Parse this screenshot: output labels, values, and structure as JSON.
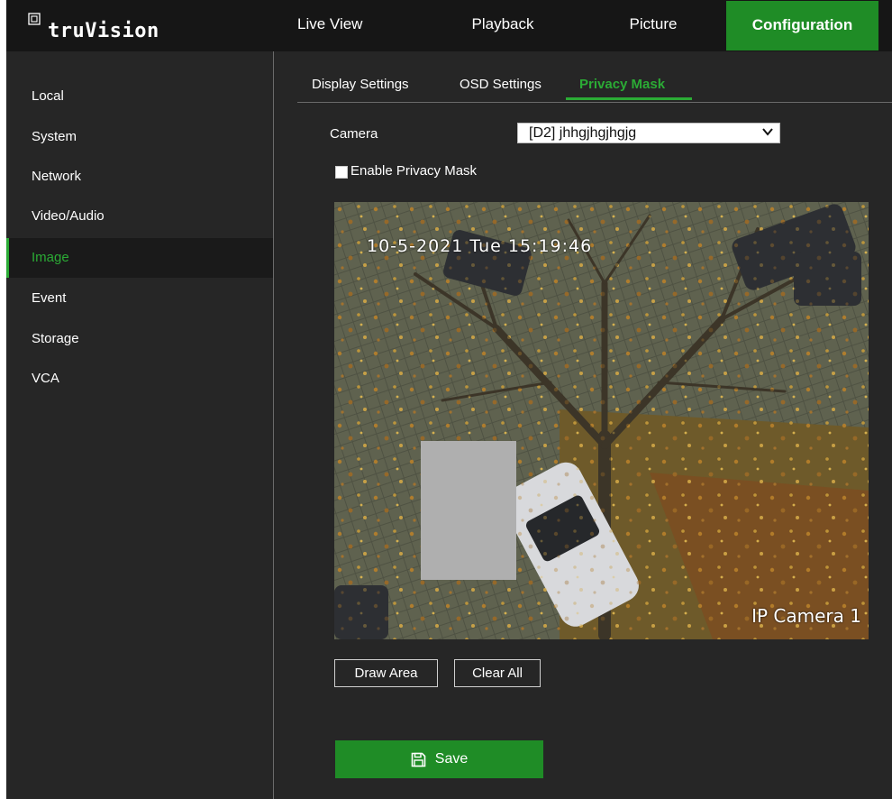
{
  "app": {
    "brand": "truVision"
  },
  "topnav": [
    {
      "label": "Live View"
    },
    {
      "label": "Playback"
    },
    {
      "label": "Picture"
    },
    {
      "label": "Configuration",
      "active": true
    }
  ],
  "sidebar": {
    "items": [
      {
        "label": "Local"
      },
      {
        "label": "System"
      },
      {
        "label": "Network"
      },
      {
        "label": "Video/Audio"
      },
      {
        "label": "Image",
        "active": true
      },
      {
        "label": "Event"
      },
      {
        "label": "Storage"
      },
      {
        "label": "VCA"
      }
    ]
  },
  "tabs": [
    {
      "label": "Display Settings"
    },
    {
      "label": "OSD Settings"
    },
    {
      "label": "Privacy Mask",
      "active": true
    }
  ],
  "form": {
    "camera_label": "Camera",
    "camera_value": "[D2] jhhgjhgjhgjg",
    "enable_label": "Enable Privacy Mask",
    "enable_checked": false
  },
  "video": {
    "osd_time": "10-5-2021 Tue 15:19:46",
    "osd_name": "IP Camera 1"
  },
  "buttons": {
    "draw_area": "Draw Area",
    "clear_all": "Clear All",
    "save": "Save"
  },
  "colors": {
    "accent": "#1f8c26",
    "active_text": "#2bab35",
    "background": "#262626",
    "topbar": "#161616",
    "mask": "#afafaf"
  },
  "icons": {
    "logo": "truvision-logo-icon",
    "dropdown": "chevron-down-icon",
    "save": "save-floppy-icon"
  }
}
